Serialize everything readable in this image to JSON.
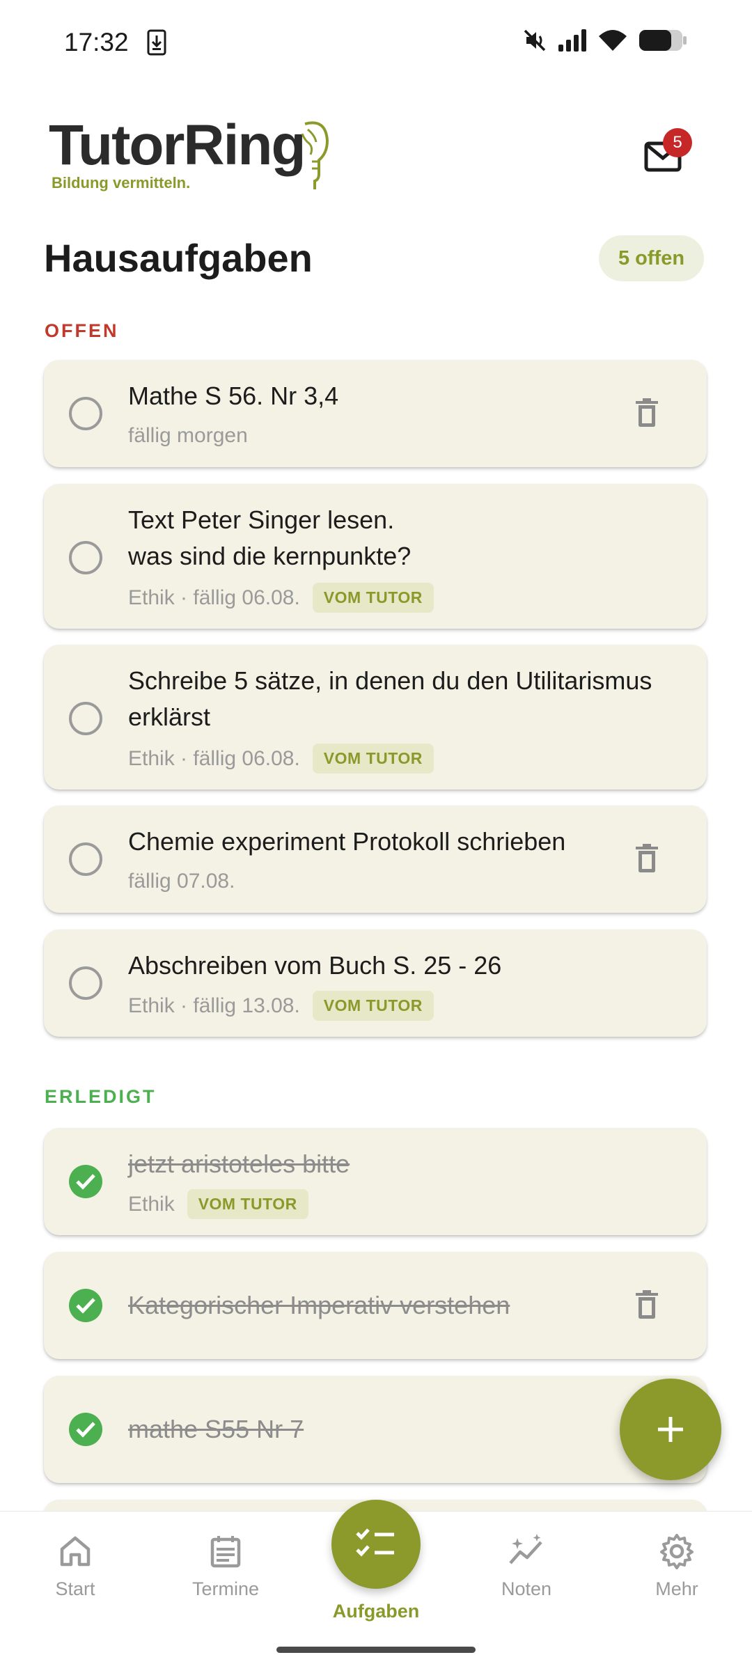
{
  "status_bar": {
    "time": "17:32",
    "icons": [
      "download-icon",
      "mute-icon",
      "signal-icon",
      "wifi-icon",
      "battery-icon"
    ]
  },
  "header": {
    "logo_text": "TutorRing",
    "logo_tagline": "Bildung vermitteln.",
    "mail_badge": "5"
  },
  "page": {
    "title": "Hausaufgaben",
    "open_count": "5 offen"
  },
  "sections": {
    "open_label": "OFFEN",
    "done_label": "ERLEDIGT"
  },
  "open_tasks": [
    {
      "title": "Mathe S 56. Nr 3,4",
      "meta": "fällig morgen",
      "tag": "",
      "deletable": true
    },
    {
      "title": "Text Peter Singer lesen.\nwas sind die kernpunkte?",
      "meta": "Ethik · fällig 06.08.",
      "tag": "VOM TUTOR",
      "deletable": false
    },
    {
      "title": "Schreibe 5 sätze, in denen du den Utilitarismus erklärst",
      "meta": "Ethik · fällig 06.08.",
      "tag": "VOM TUTOR",
      "deletable": false
    },
    {
      "title": "Chemie experiment Protokoll schrieben",
      "meta": "fällig 07.08.",
      "tag": "",
      "deletable": true
    },
    {
      "title": "Abschreiben vom Buch S. 25 - 26",
      "meta": "Ethik · fällig 13.08.",
      "tag": "VOM TUTOR",
      "deletable": false
    }
  ],
  "done_tasks": [
    {
      "title": "jetzt aristoteles bitte",
      "meta": "Ethik",
      "tag": "VOM TUTOR",
      "deletable": false
    },
    {
      "title": "Kategorischer Imperativ verstehen",
      "meta": "",
      "tag": "",
      "deletable": true
    },
    {
      "title": "mathe S55 Nr 7",
      "meta": "",
      "tag": "",
      "deletable": false
    }
  ],
  "fab": {
    "icon": "plus-icon"
  },
  "bottom_nav": [
    {
      "label": "Start",
      "icon": "home-icon"
    },
    {
      "label": "Termine",
      "icon": "calendar-icon"
    },
    {
      "label": "Aufgaben",
      "icon": "tasks-icon",
      "active": true
    },
    {
      "label": "Noten",
      "icon": "chart-icon"
    },
    {
      "label": "Mehr",
      "icon": "gear-icon"
    }
  ],
  "colors": {
    "accent": "#8c9a2c",
    "card": "#f3f2e4",
    "open_label": "#c0392b",
    "done_label": "#4caf50",
    "badge": "#c62828"
  }
}
